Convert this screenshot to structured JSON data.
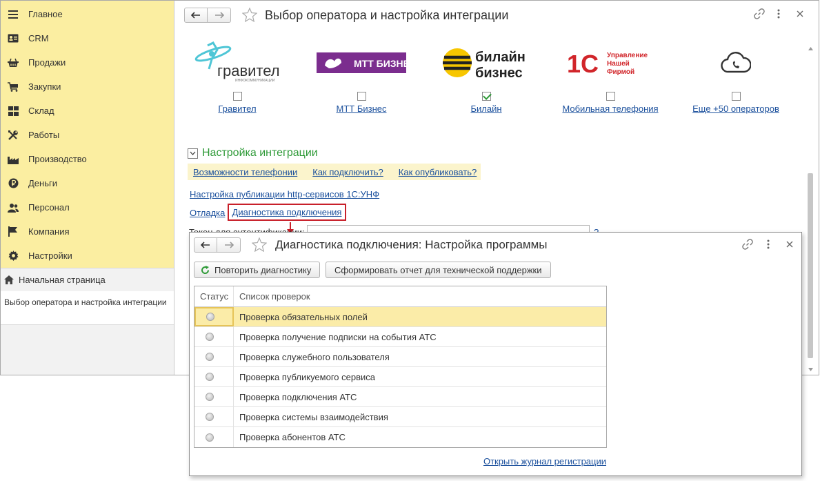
{
  "sidebar": {
    "items": [
      {
        "label": "Главное",
        "icon": "menu-icon"
      },
      {
        "label": "CRM",
        "icon": "contact-card-icon"
      },
      {
        "label": "Продажи",
        "icon": "basket-icon"
      },
      {
        "label": "Закупки",
        "icon": "cart-icon"
      },
      {
        "label": "Склад",
        "icon": "warehouse-grid-icon"
      },
      {
        "label": "Работы",
        "icon": "tools-icon"
      },
      {
        "label": "Производство",
        "icon": "factory-icon"
      },
      {
        "label": "Деньги",
        "icon": "ruble-coin-icon"
      },
      {
        "label": "Персонал",
        "icon": "people-icon"
      },
      {
        "label": "Компания",
        "icon": "flag-icon"
      },
      {
        "label": "Настройки",
        "icon": "gear-icon"
      }
    ],
    "home_label": "Начальная страница",
    "open_window_label": "Выбор оператора и настройка интеграции"
  },
  "main": {
    "title": "Выбор оператора и настройка интеграции",
    "operators": [
      {
        "label": "Гравител",
        "checked": false,
        "logo_text": "гравител",
        "logo_sub": "ИНФОКОММУНИКАЦИИ"
      },
      {
        "label": "МТТ Бизнес",
        "checked": false,
        "logo_text": "МТТ БИЗНЕС"
      },
      {
        "label": "Билайн",
        "checked": true,
        "logo_line1": "билайн",
        "logo_line2": "бизнес"
      },
      {
        "label": "Мобильная телефония",
        "checked": false,
        "logo_line1": "Управление",
        "logo_line2": "Нашей",
        "logo_line3": "Фирмой"
      },
      {
        "label": "Еще +50 операторов",
        "checked": false
      }
    ],
    "integration": {
      "header": "Настройка интеграции",
      "help_links": [
        "Возможности телефонии",
        "Как подключить?",
        "Как опубликовать?"
      ],
      "publish_link": "Настройка публикации http-сервисов 1С:УНФ",
      "debug_link": "Отладка",
      "diagnostics_link": "Диагностика подключения",
      "token_label": "Токен для аутентификации:",
      "token_help": "?"
    }
  },
  "dialog": {
    "title": "Диагностика подключения: Настройка программы",
    "repeat_button": "Повторить диагностику",
    "report_button": "Сформировать отчет для технической поддержки",
    "columns": [
      "Статус",
      "Список проверок"
    ],
    "checks": [
      "Проверка обязательных полей",
      "Проверка получение подписки на события АТС",
      "Проверка служебного пользователя",
      "Проверка публикуемого сервиса",
      "Проверка подключения АТС",
      "Проверка системы взаимодействия",
      "Проверка абонентов АТС"
    ],
    "journal_link": "Открыть журнал регистрации"
  },
  "colors": {
    "sidebar_bg": "#fbeea1",
    "accent_green": "#2e9a37",
    "link": "#1a4f9c",
    "highlight_red": "#c8202a",
    "mtt_purple": "#7b2d8e",
    "beeline_yellow": "#f7c600",
    "onec_red": "#d1252a"
  }
}
